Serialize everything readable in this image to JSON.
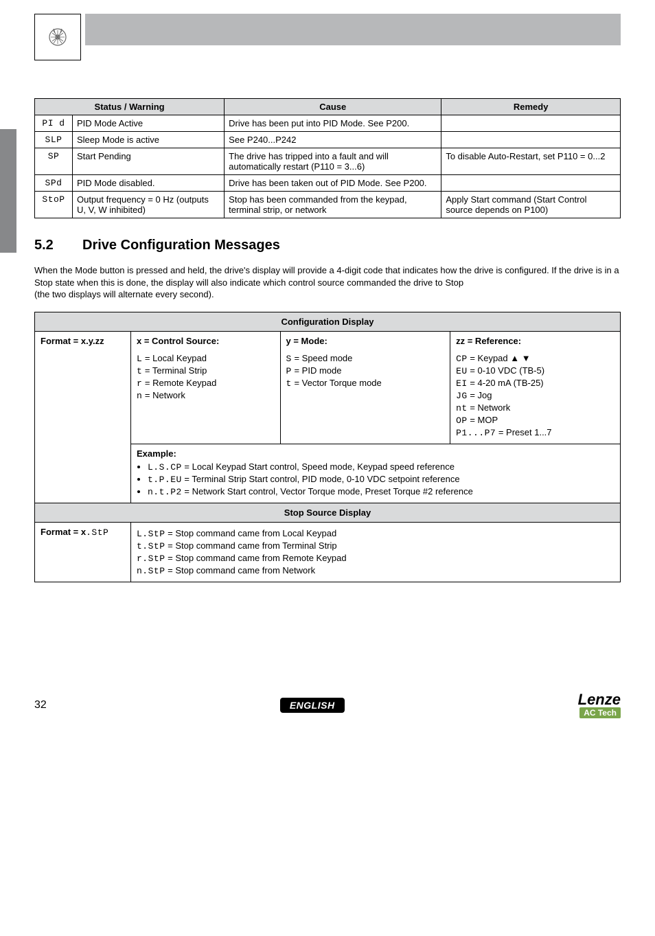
{
  "table1": {
    "headers": [
      "Status / Warning",
      "Cause",
      "Remedy"
    ],
    "rows": [
      {
        "code": "PI d",
        "status": "PID Mode Active",
        "cause": "Drive has been put into PID Mode. See P200.",
        "remedy": ""
      },
      {
        "code": "SLP",
        "status": "Sleep Mode is active",
        "cause": "See P240...P242",
        "remedy": ""
      },
      {
        "code": "SP",
        "status": "Start Pending",
        "cause": "The drive has tripped into a fault and will automatically restart (P110 = 3...6)",
        "remedy": "To disable Auto-Restart, set P110 = 0...2"
      },
      {
        "code": "SPd",
        "status": "PID Mode disabled.",
        "cause": "Drive has been taken out of PID Mode. See P200.",
        "remedy": ""
      },
      {
        "code": "StoP",
        "status": "Output frequency = 0 Hz (outputs U, V, W inhibited)",
        "cause": "Stop has been commanded from the keypad, terminal strip, or network",
        "remedy": "Apply Start command (Start Control source depends on P100)"
      }
    ]
  },
  "section": {
    "num": "5.2",
    "title": "Drive Configuration Messages",
    "para": "When the Mode button is pressed and held, the drive's display will provide a 4-digit code that indicates how the drive is configured.  If the drive is in a Stop state when this is done, the display will also indicate which control source commanded the drive to Stop",
    "para2": "(the two displays will alternate every second)."
  },
  "cfg": {
    "title": "Configuration Display",
    "format_label": "Format = x.y.zz",
    "x_header": "x = Control Source:",
    "y_header": "y = Mode:",
    "z_header": "zz = Reference:",
    "x_items": [
      {
        "code": "L",
        "desc": "Local Keypad"
      },
      {
        "code": "t",
        "desc": "Terminal Strip"
      },
      {
        "code": "r",
        "desc": "Remote Keypad"
      },
      {
        "code": "n",
        "desc": "Network"
      }
    ],
    "y_items": [
      {
        "code": "S",
        "desc": "Speed mode"
      },
      {
        "code": "P",
        "desc": "PID mode"
      },
      {
        "code": "t",
        "desc": "Vector Torque mode"
      }
    ],
    "z_items": [
      {
        "code": "CP",
        "desc": "Keypad ▲ ▼"
      },
      {
        "code": "EU",
        "desc": "0-10 VDC (TB-5)"
      },
      {
        "code": "EI",
        "desc": "4-20 mA (TB-25)"
      },
      {
        "code": "JG",
        "desc": "Jog"
      },
      {
        "code": "nt",
        "desc": "Network"
      },
      {
        "code": "OP",
        "desc": "MOP"
      },
      {
        "code": "P1...P7",
        "desc": "Preset 1...7"
      }
    ],
    "example_label": "Example:",
    "examples": [
      {
        "code": "L.S.CP",
        "desc": "Local Keypad Start control, Speed mode, Keypad speed reference"
      },
      {
        "code": "t.P.EU",
        "desc": "Terminal Strip Start control, PID mode, 0-10 VDC setpoint reference"
      },
      {
        "code": "n.t.P2",
        "desc": "Network Start control, Vector Torque mode, Preset Torque #2 reference"
      }
    ]
  },
  "stop": {
    "title": "Stop Source Display",
    "format_label": "Format = x.StP",
    "items": [
      {
        "code": "L.StP",
        "desc": "Stop command came from Local Keypad"
      },
      {
        "code": "t.StP",
        "desc": "Stop command came from Terminal Strip"
      },
      {
        "code": "r.StP",
        "desc": "Stop command came from Remote Keypad"
      },
      {
        "code": "n.StP",
        "desc": "Stop command came from Network"
      }
    ]
  },
  "footer": {
    "page": "32",
    "lang": "ENGLISH",
    "brand1": "Lenze",
    "brand2": "AC Tech"
  }
}
